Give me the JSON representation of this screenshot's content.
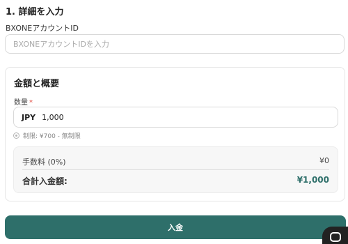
{
  "details": {
    "title": "1. 詳細を入力",
    "account_label": "BXONEアカウントID",
    "account_placeholder": "BXONEアカウントIDを入力",
    "account_value": ""
  },
  "amount_card": {
    "title": "金額と概要",
    "quantity_label": "数量",
    "required_mark": "*",
    "currency": "JPY",
    "amount_value": "1,000",
    "limit_text": "制限: ¥700 - 無制限",
    "fee_label": "手数料 (0%)",
    "fee_value": "¥0",
    "total_label": "合計入金額:",
    "total_value": "¥1,000"
  },
  "deposit_button_label": "入金",
  "icons": {
    "info": "info-icon",
    "chat": "chat-icon"
  },
  "colors": {
    "accent": "#2e6f6a",
    "required": "#e0463c"
  }
}
